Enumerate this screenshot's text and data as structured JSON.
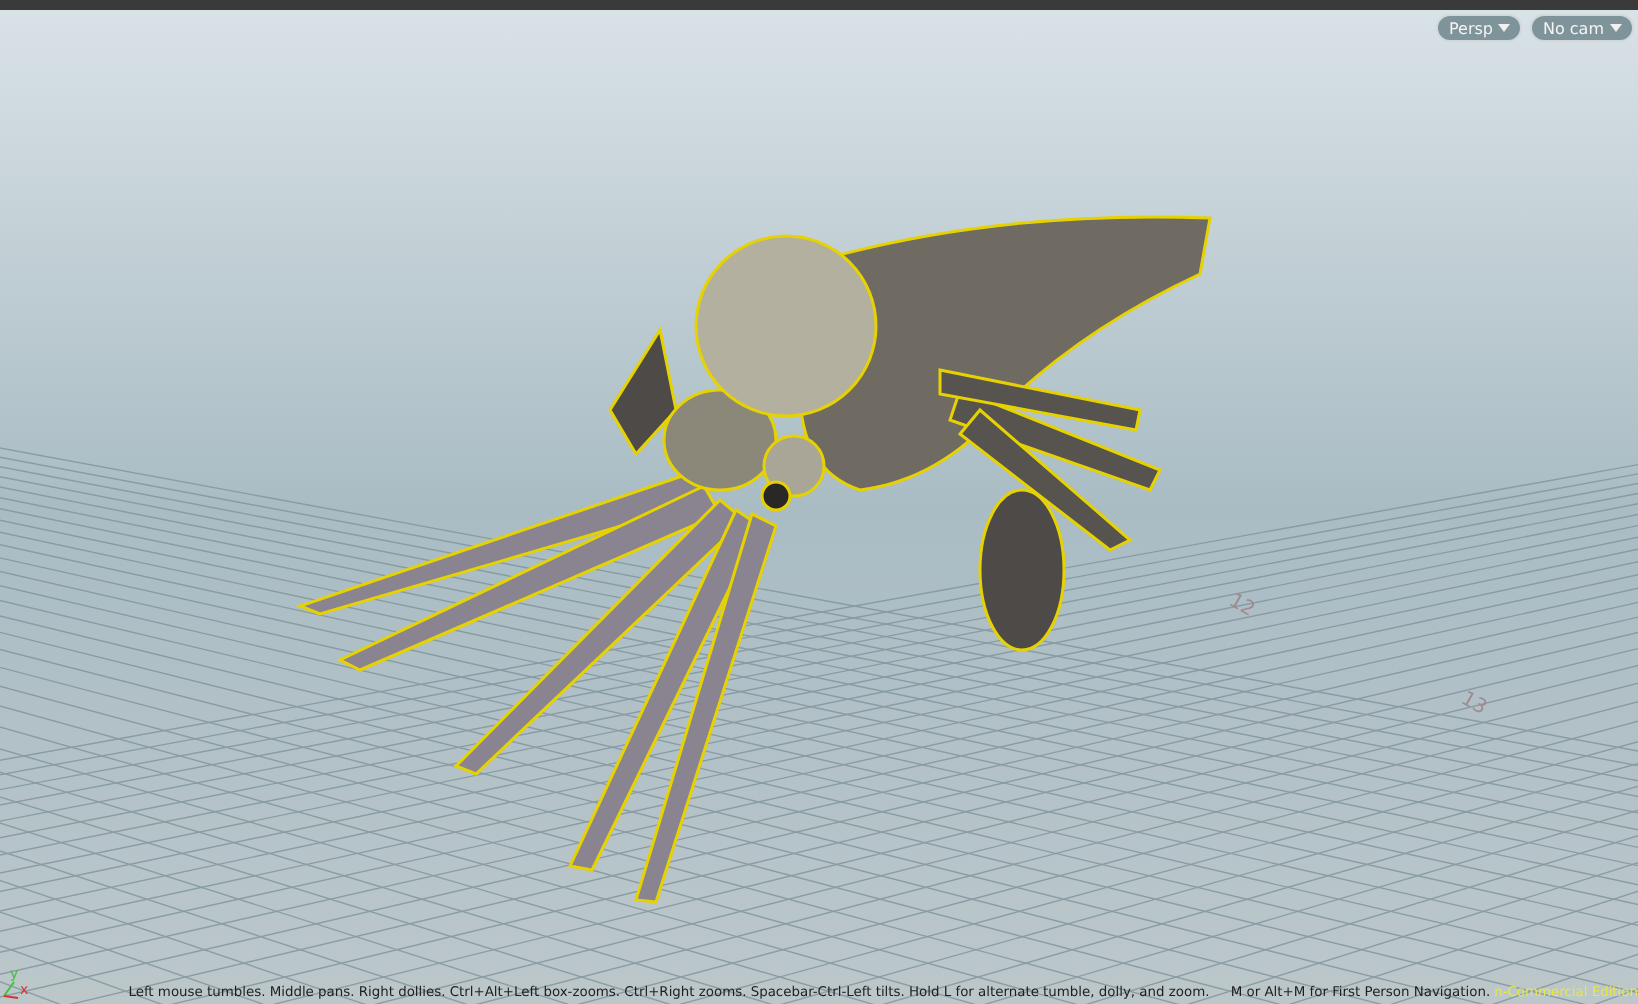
{
  "viewport": {
    "view_menu": "Persp",
    "camera_menu": "No cam",
    "grid_labels": [
      "12",
      "13"
    ],
    "axes": {
      "y": "y",
      "x": "x"
    },
    "hint": "Left mouse tumbles. Middle pans. Right dollies. Ctrl+Alt+Left box-zooms. Ctrl+Right zooms. Spacebar-Ctrl-Left tilts. Hold L for alternate tumble, dolly, and zoom.     M or Alt+M for First Person Navigation.",
    "edition": "n-Commercial Edition"
  }
}
